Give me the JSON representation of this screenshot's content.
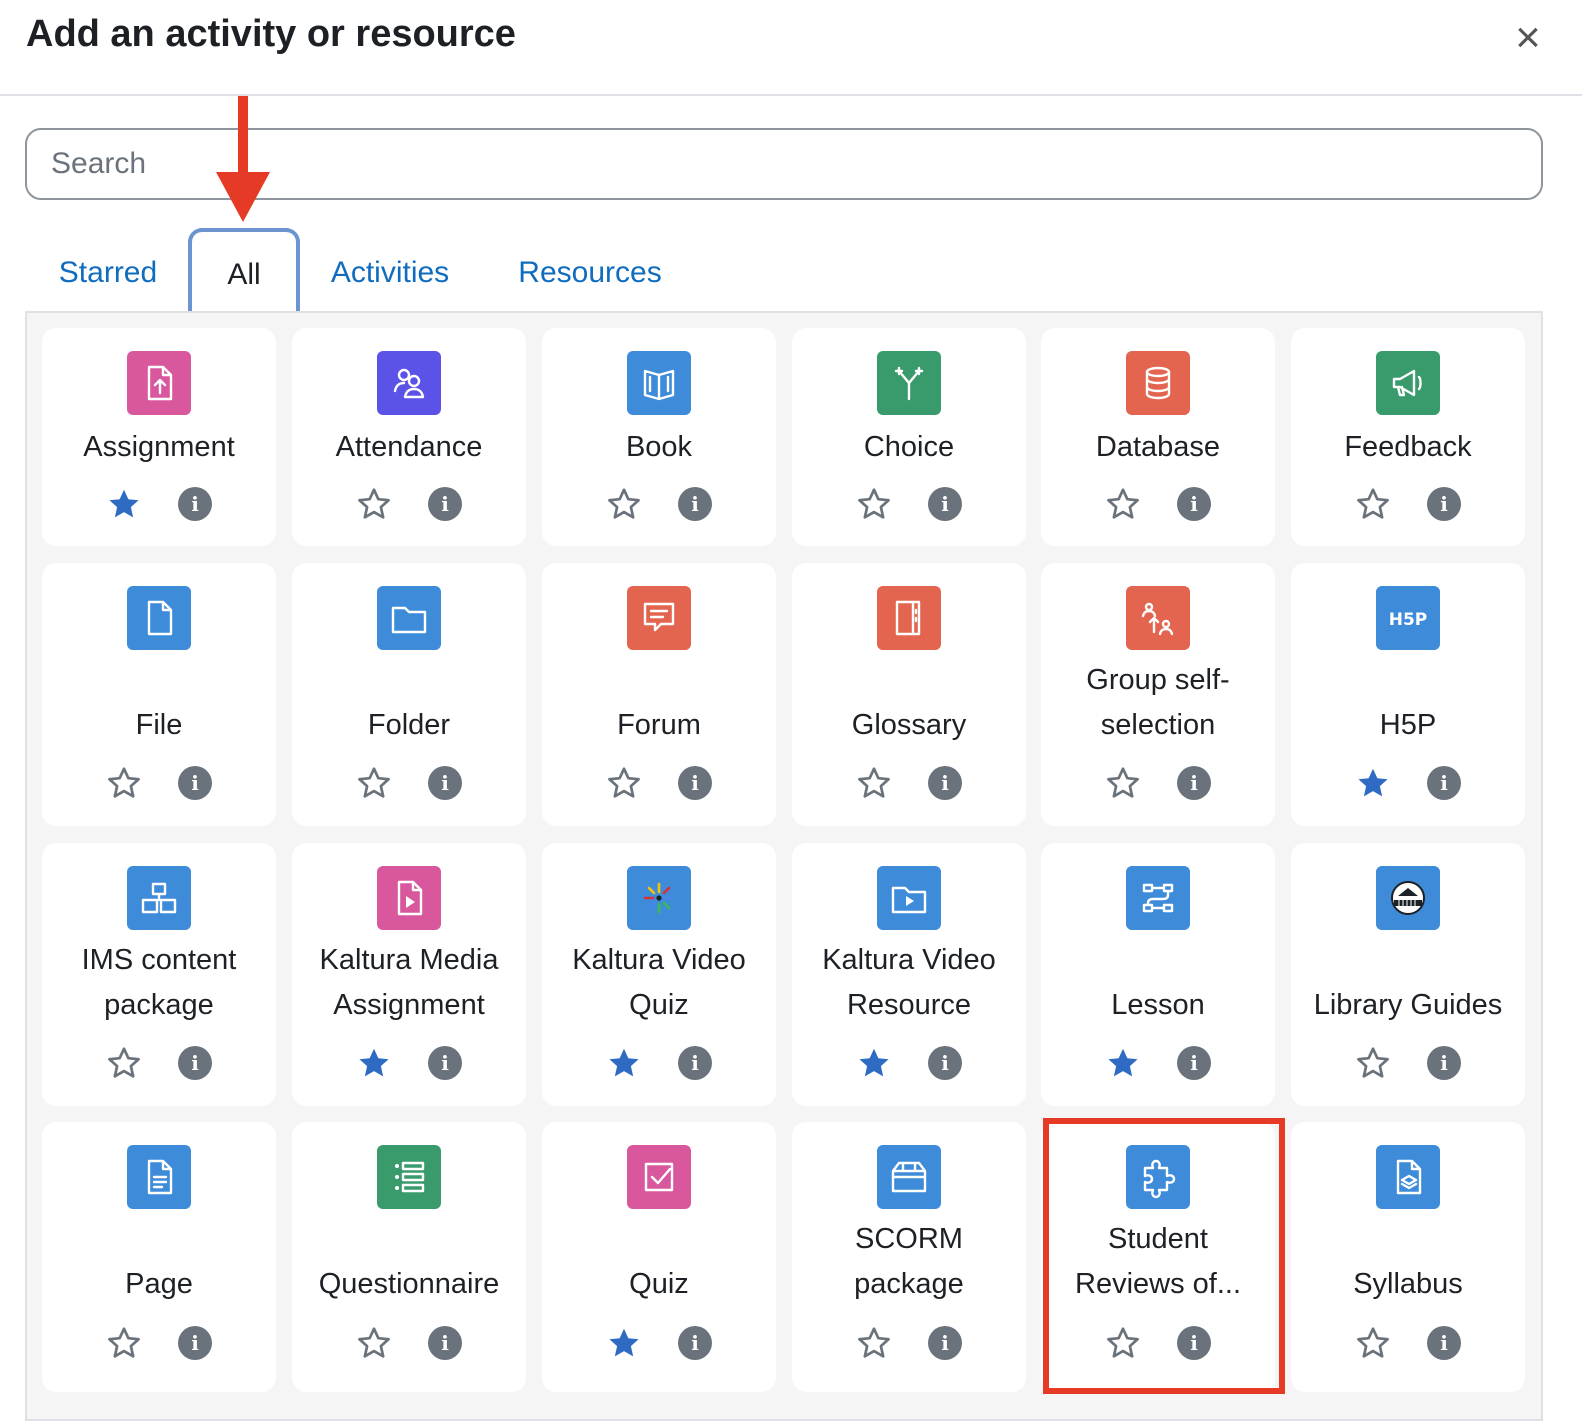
{
  "dialog": {
    "title": "Add an activity or resource",
    "close_label": "×"
  },
  "search": {
    "placeholder": "Search",
    "value": ""
  },
  "tabs": [
    {
      "label": "Starred",
      "active": false
    },
    {
      "label": "All",
      "active": true
    },
    {
      "label": "Activities",
      "active": false
    },
    {
      "label": "Resources",
      "active": false
    }
  ],
  "info_glyph": "i",
  "items": [
    {
      "name": "Assignment",
      "icon": "assignment-icon",
      "color": "#d9589d",
      "starred": true
    },
    {
      "name": "Attendance",
      "icon": "attendance-icon",
      "color": "#5b52e8",
      "starred": false
    },
    {
      "name": "Book",
      "icon": "book-icon",
      "color": "#3d8bd9",
      "starred": false
    },
    {
      "name": "Choice",
      "icon": "choice-icon",
      "color": "#399b6c",
      "starred": false
    },
    {
      "name": "Database",
      "icon": "database-icon",
      "color": "#e4654f",
      "starred": false
    },
    {
      "name": "Feedback",
      "icon": "feedback-icon",
      "color": "#399b6c",
      "starred": false
    },
    {
      "name": "File",
      "icon": "file-icon",
      "color": "#3d8bd9",
      "starred": false
    },
    {
      "name": "Folder",
      "icon": "folder-icon",
      "color": "#3d8bd9",
      "starred": false
    },
    {
      "name": "Forum",
      "icon": "forum-icon",
      "color": "#e4654f",
      "starred": false
    },
    {
      "name": "Glossary",
      "icon": "glossary-icon",
      "color": "#e4654f",
      "starred": false
    },
    {
      "name": "Group self-selection",
      "icon": "group-selection-icon",
      "color": "#e4654f",
      "starred": false
    },
    {
      "name": "H5P",
      "icon": "h5p-icon",
      "color": "#3d8bd9",
      "starred": true
    },
    {
      "name": "IMS content package",
      "icon": "ims-package-icon",
      "color": "#3d8bd9",
      "starred": false
    },
    {
      "name": "Kaltura Media Assignment",
      "icon": "kaltura-media-icon",
      "color": "#d9589d",
      "starred": true
    },
    {
      "name": "Kaltura Video Quiz",
      "icon": "kaltura-quiz-icon",
      "color": "#3d8bd9",
      "starred": true
    },
    {
      "name": "Kaltura Video Resource",
      "icon": "kaltura-video-icon",
      "color": "#3d8bd9",
      "starred": true
    },
    {
      "name": "Lesson",
      "icon": "lesson-icon",
      "color": "#3d8bd9",
      "starred": true
    },
    {
      "name": "Library Guides",
      "icon": "library-guides-icon",
      "color": "#3d8bd9",
      "starred": false
    },
    {
      "name": "Page",
      "icon": "page-icon",
      "color": "#3d8bd9",
      "starred": false
    },
    {
      "name": "Questionnaire",
      "icon": "questionnaire-icon",
      "color": "#399b6c",
      "starred": false
    },
    {
      "name": "Quiz",
      "icon": "quiz-icon",
      "color": "#d9589d",
      "starred": true
    },
    {
      "name": "SCORM package",
      "icon": "scorm-icon",
      "color": "#3d8bd9",
      "starred": false
    },
    {
      "name": "Student Reviews of...",
      "icon": "puzzle-icon",
      "color": "#3d8bd9",
      "starred": false
    },
    {
      "name": "Syllabus",
      "icon": "syllabus-icon",
      "color": "#3d8bd9",
      "starred": false
    }
  ],
  "colors": {
    "link": "#0f6cbf",
    "star_filled": "#2f6ac3",
    "star_outline": "#6a737b",
    "annotation_red": "#e53a25",
    "tab_highlight": "#6b94d0"
  }
}
